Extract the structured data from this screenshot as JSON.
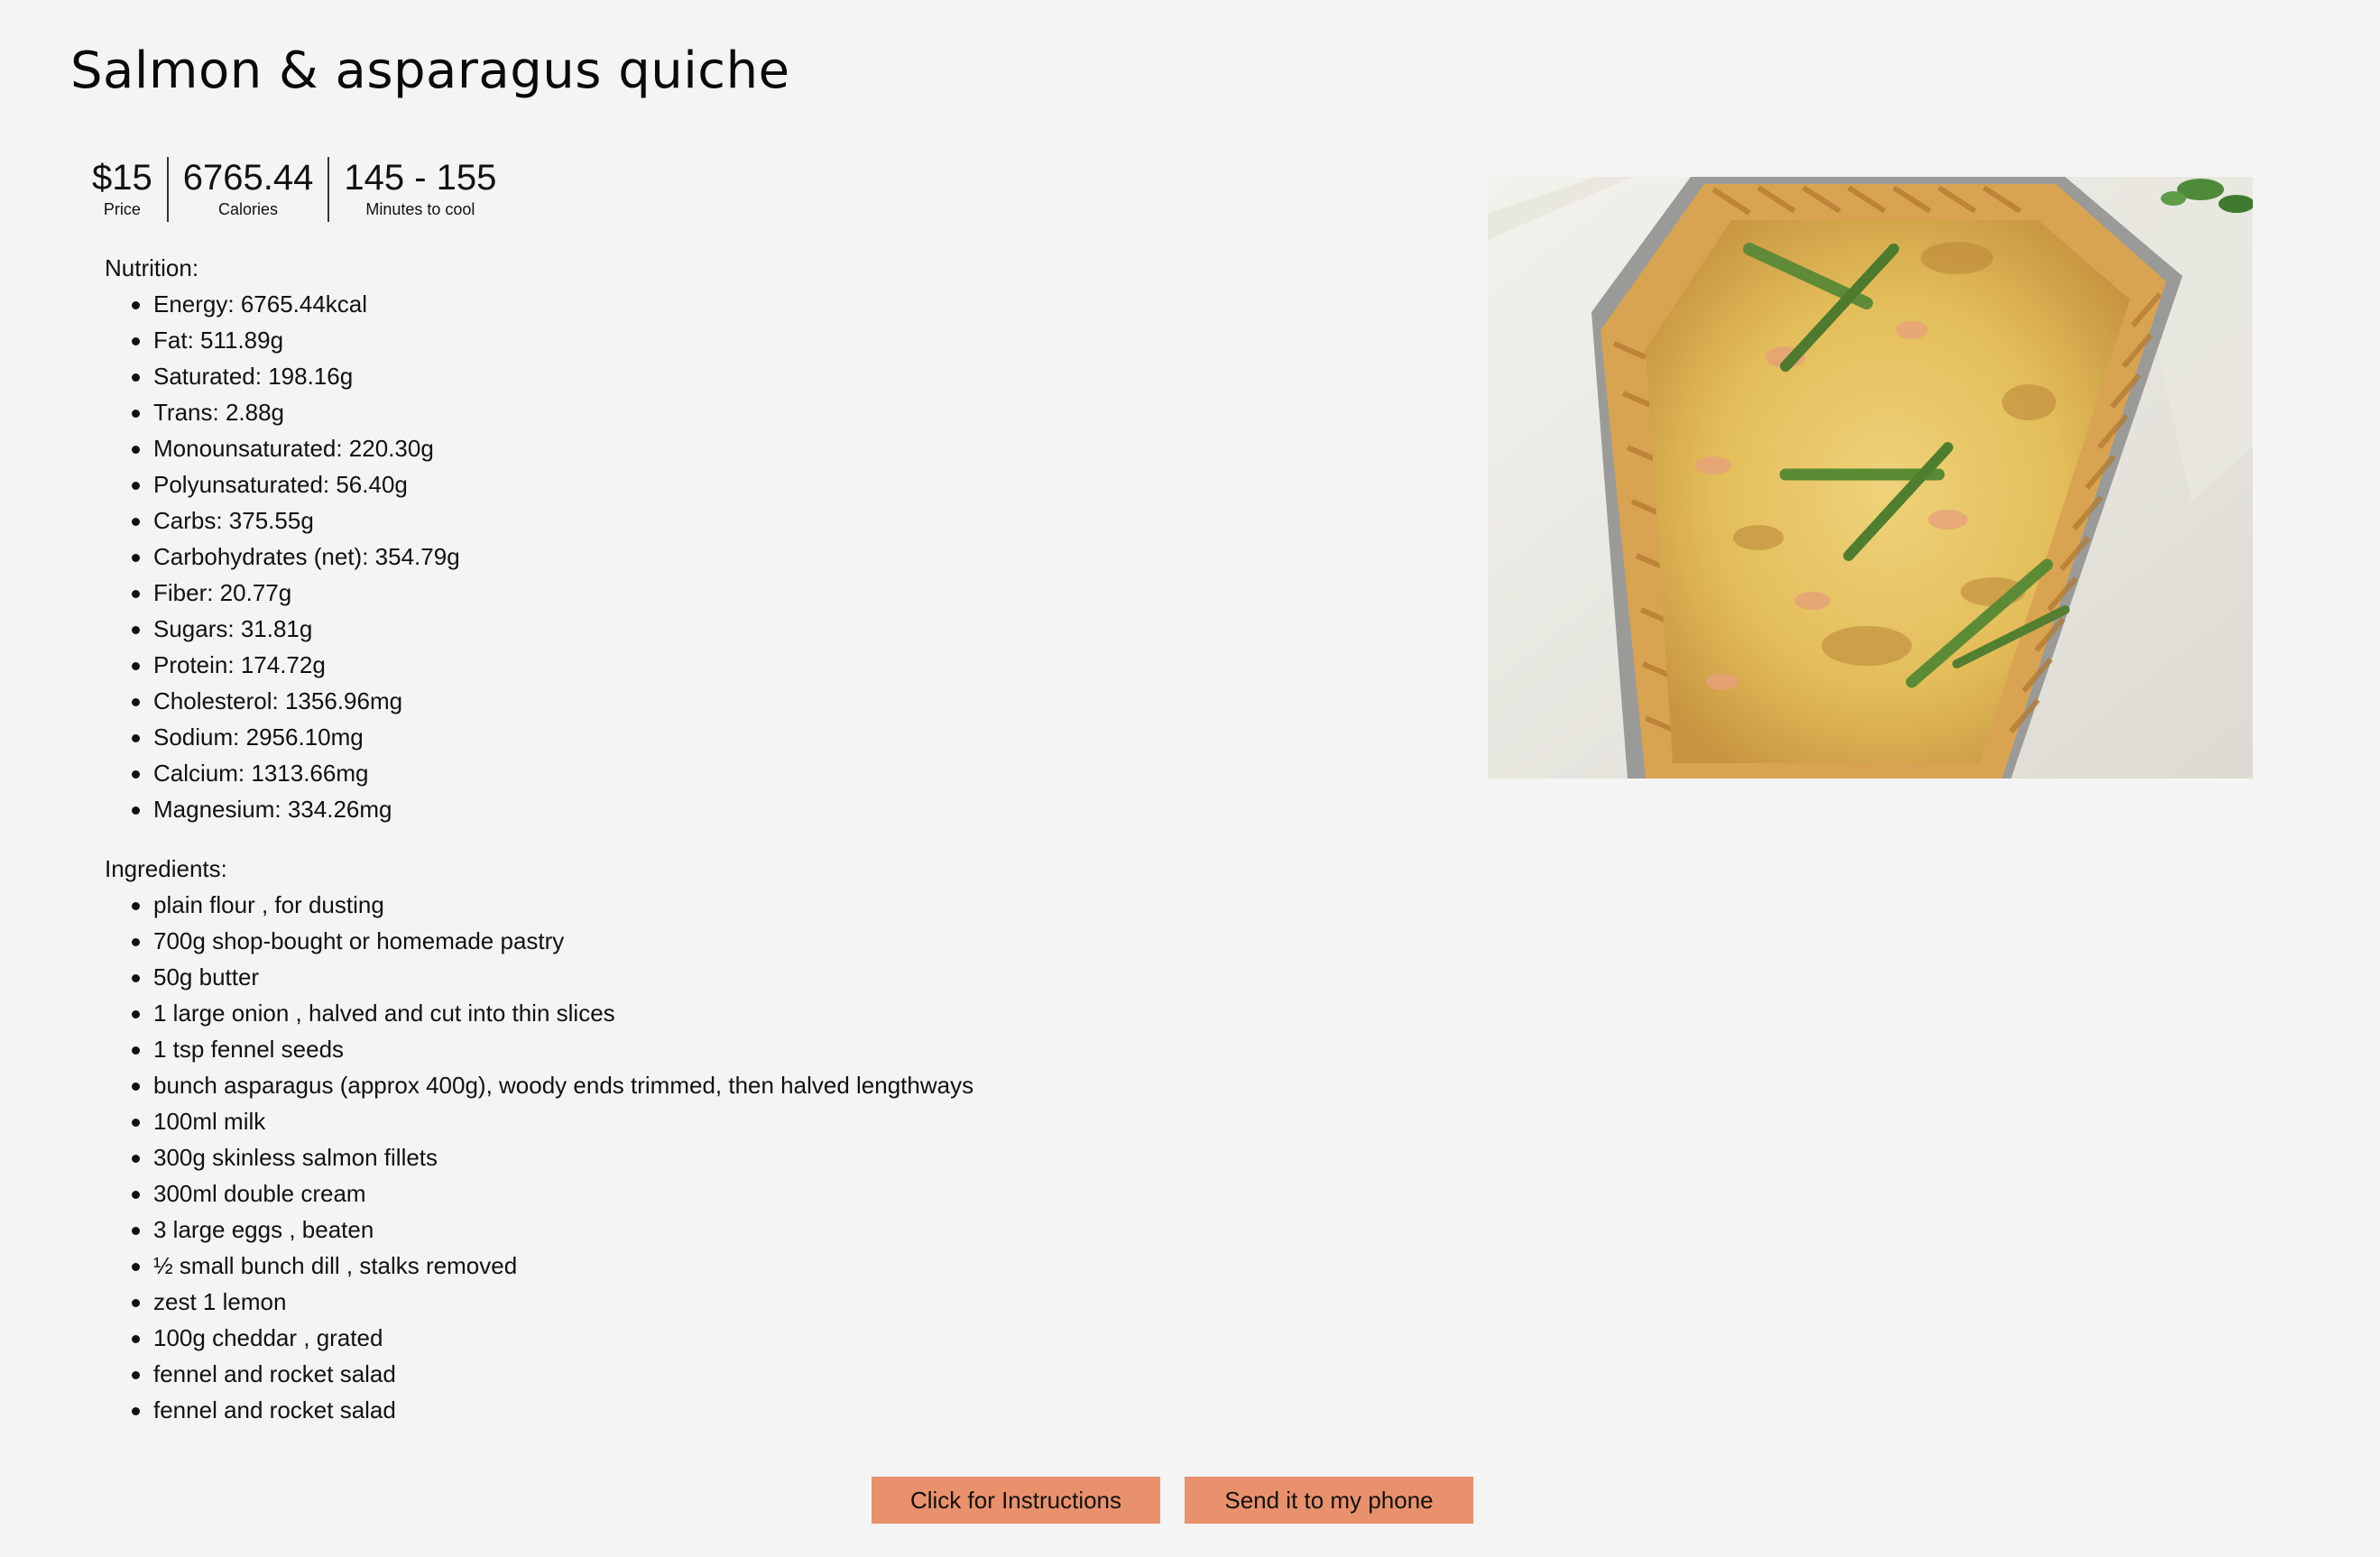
{
  "recipe": {
    "title": "Salmon & asparagus quiche"
  },
  "stats": [
    {
      "value": "$15",
      "label": "Price"
    },
    {
      "value": "6765.44",
      "label": "Calories"
    },
    {
      "value": "145 - 155",
      "label": "Minutes to cool"
    }
  ],
  "nutrition": {
    "heading": "Nutrition:",
    "items": [
      "Energy: 6765.44kcal",
      "Fat: 511.89g",
      "Saturated: 198.16g",
      "Trans: 2.88g",
      "Monounsaturated: 220.30g",
      "Polyunsaturated: 56.40g",
      "Carbs: 375.55g",
      "Carbohydrates (net): 354.79g",
      "Fiber: 20.77g",
      "Sugars: 31.81g",
      "Protein: 174.72g",
      "Cholesterol: 1356.96mg",
      "Sodium: 2956.10mg",
      "Calcium: 1313.66mg",
      "Magnesium: 334.26mg"
    ]
  },
  "ingredients": {
    "heading": "Ingredients:",
    "items": [
      "plain flour , for dusting",
      "700g shop-bought or homemade pastry",
      "50g butter",
      "1 large onion , halved and cut into thin slices",
      "1 tsp fennel seeds",
      "bunch asparagus (approx 400g), woody ends trimmed, then halved lengthways",
      "100ml milk",
      "300g skinless salmon fillets",
      "300ml double cream",
      "3 large eggs , beaten",
      "½ small bunch dill , stalks removed",
      "zest 1 lemon",
      "100g cheddar , grated",
      "fennel and rocket salad",
      "fennel and rocket salad"
    ]
  },
  "actions": {
    "instructions_label": "Click for Instructions",
    "send_label": "Send it to my phone"
  },
  "colors": {
    "background": "#f4f4f4",
    "button": "#e9916c"
  }
}
